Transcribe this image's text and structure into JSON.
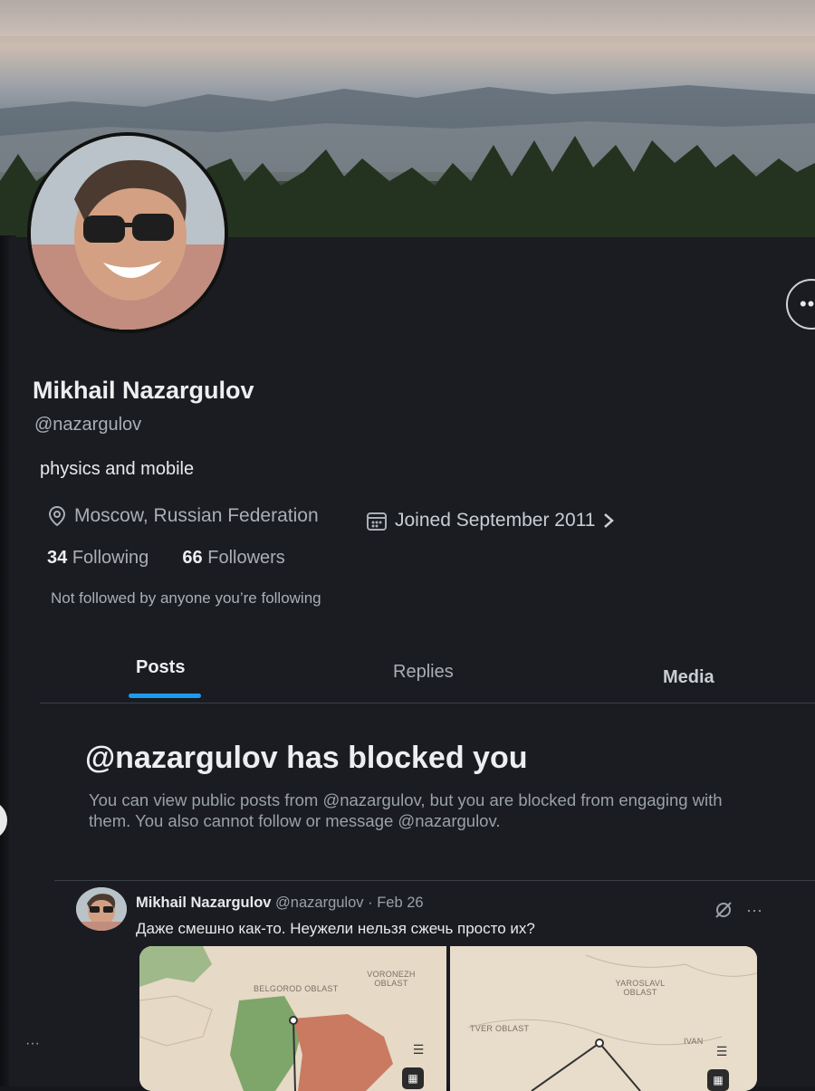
{
  "profile": {
    "name": "Mikhail Nazargulov",
    "handle": "@nazargulov",
    "bio": "physics and mobile",
    "location": "Moscow, Russian Federation",
    "joined": "Joined September 2011",
    "following_count": "34",
    "following_label": "Following",
    "followers_count": "66",
    "followers_label": "Followers",
    "mutuals_note": "Not followed by anyone you’re following"
  },
  "tabs": [
    {
      "label": "Posts",
      "active": true
    },
    {
      "label": "Replies",
      "active": false
    },
    {
      "label": "Media",
      "active": false
    }
  ],
  "blocked": {
    "title": "@nazargulov has blocked you",
    "text": "You can view public posts from @nazargulov, but you are blocked from engaging with them. You also cannot follow or message @nazargulov."
  },
  "post": {
    "author": "Mikhail Nazargulov",
    "handle": "@nazargulov",
    "date": "Feb 26",
    "separator": "·",
    "text": "Даже смешно как-то. Неужели нельзя сжечь просто их?",
    "maps": [
      {
        "labels": [
          "VORONEZH OBLAST",
          "BELGOROD OBLAST"
        ]
      },
      {
        "labels": [
          "YAROSLAVL OBLAST",
          "TVER OBLAST",
          "IVAN"
        ]
      }
    ]
  },
  "icons": {
    "more": "more-horizontal-icon",
    "location": "location-pin-icon",
    "calendar": "calendar-icon",
    "chevron": "chevron-right-icon",
    "grok": "grok-slash-icon",
    "post_more": "ellipsis-icon"
  },
  "colors": {
    "accent": "#1d9bf0",
    "background": "#15171c"
  }
}
